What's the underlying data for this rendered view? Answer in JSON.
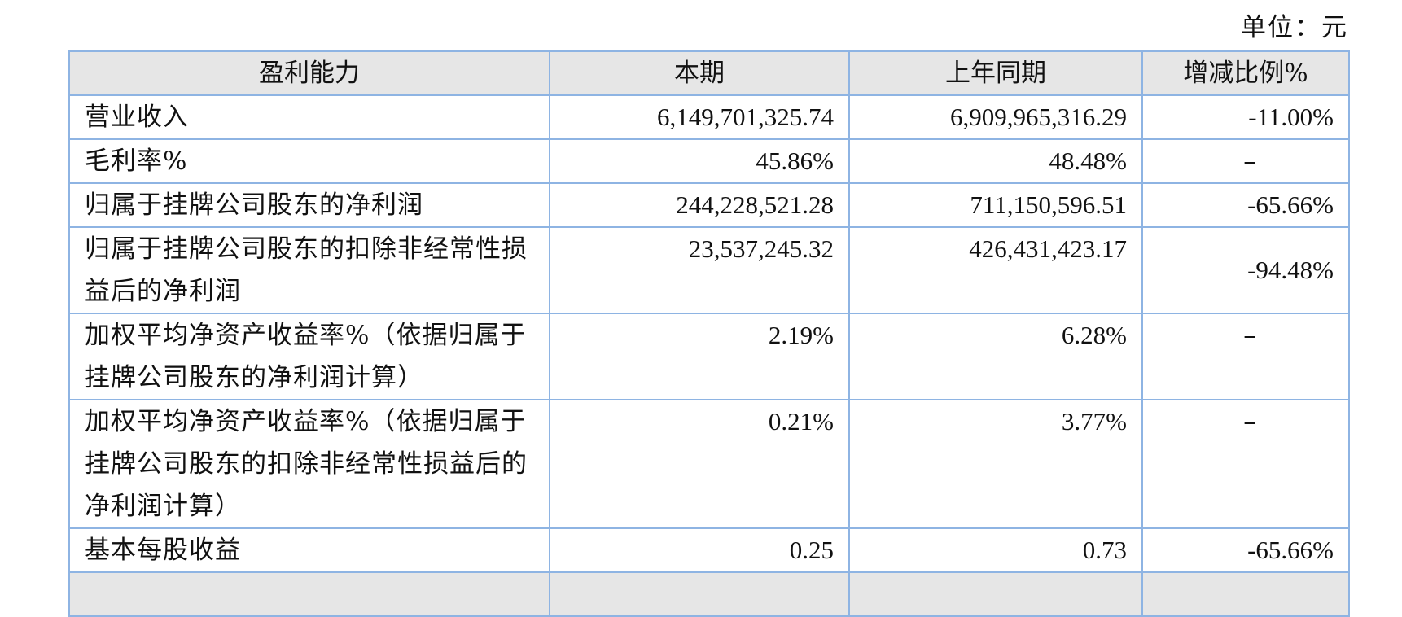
{
  "unit_label": "单位：元",
  "table": {
    "headers": [
      "盈利能力",
      "本期",
      "上年同期",
      "增减比例%"
    ],
    "rows": [
      {
        "label": "营业收入",
        "current": "6,149,701,325.74",
        "previous": "6,909,965,316.29",
        "change": "-11.00%"
      },
      {
        "label": "毛利率%",
        "current": "45.86%",
        "previous": "48.48%",
        "change": "–"
      },
      {
        "label": "归属于挂牌公司股东的净利润",
        "current": "244,228,521.28",
        "previous": "711,150,596.51",
        "change": "-65.66%"
      },
      {
        "label": "归属于挂牌公司股东的扣除非经常性损益后的净利润",
        "current": "23,537,245.32",
        "previous": "426,431,423.17",
        "change": "-94.48%"
      },
      {
        "label": "加权平均净资产收益率%（依据归属于挂牌公司股东的净利润计算）",
        "current": "2.19%",
        "previous": "6.28%",
        "change": "–"
      },
      {
        "label": "加权平均净资产收益率%（依据归属于挂牌公司股东的扣除非经常性损益后的净利润计算）",
        "current": "0.21%",
        "previous": "3.77%",
        "change": "–"
      },
      {
        "label": "基本每股收益",
        "current": "0.25",
        "previous": "0.73",
        "change": "-65.66%"
      }
    ]
  }
}
